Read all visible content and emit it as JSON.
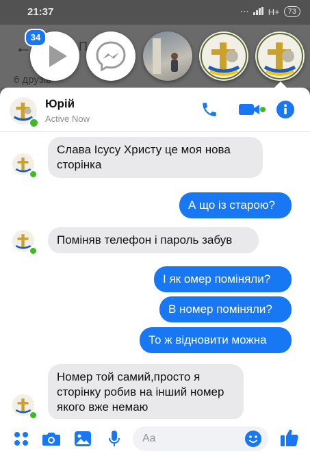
{
  "status_bar": {
    "time": "21:37",
    "network": "H+",
    "battery": "73"
  },
  "background_page": {
    "friends_text": "6 друзів",
    "title_fragment": "П"
  },
  "chat_heads": {
    "unread_badge": "34"
  },
  "header": {
    "name": "Юрій",
    "status": "Active Now"
  },
  "messages": [
    {
      "dir": "in",
      "text": "Слава Ісусу Христу це моя нова сторінка"
    },
    {
      "dir": "out",
      "text": "А що із старою?"
    },
    {
      "dir": "in",
      "text": "Поміняв телефон і пароль забув"
    },
    {
      "dir": "out",
      "text": "І як омер поміняли?"
    },
    {
      "dir": "out",
      "text": "В номер поміняли?"
    },
    {
      "dir": "out",
      "text": "То ж відновити можна"
    },
    {
      "dir": "in",
      "text": "Номер той самий,просто я сторінку робив на інший номер якого вже немаю"
    }
  ],
  "composer": {
    "placeholder": "Aa"
  },
  "colors": {
    "accent": "#1877f2",
    "online": "#42b72a",
    "incoming_bubble": "#e9e9eb"
  },
  "icons": [
    "back-arrow-icon",
    "play-icon",
    "messenger-icon",
    "phone-icon",
    "video-camera-icon",
    "info-icon",
    "apps-icon",
    "camera-icon",
    "image-icon",
    "microphone-icon",
    "emoji-icon",
    "thumbs-up-icon"
  ]
}
